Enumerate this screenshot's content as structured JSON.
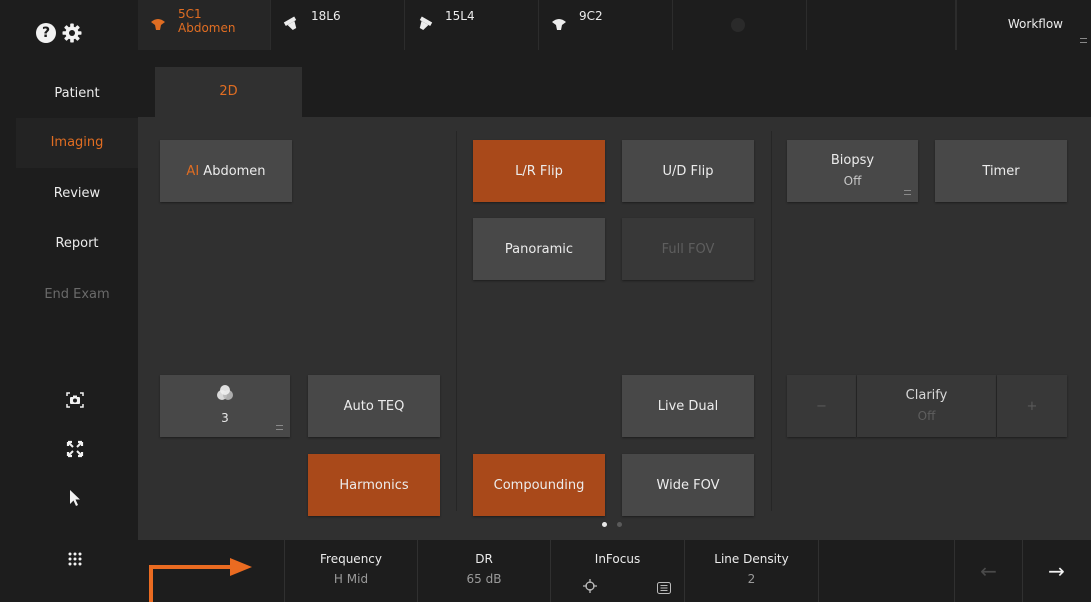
{
  "header": {
    "help_glyph": "?",
    "settings_icon": "gear-icon"
  },
  "probes": [
    {
      "name": "5C1",
      "sub": "Abdomen",
      "active": true,
      "icon": "curved-probe-icon"
    },
    {
      "name": "18L6",
      "active": false,
      "icon": "linear-probe-icon"
    },
    {
      "name": "15L4",
      "active": false,
      "icon": "linear-probe-icon"
    },
    {
      "name": "9C2",
      "active": false,
      "icon": "curved-probe-icon"
    }
  ],
  "workflow_label": "Workflow",
  "nav": [
    "Patient",
    "Imaging",
    "Review",
    "Report",
    "End Exam"
  ],
  "tab_label": "2D",
  "buttons": {
    "ai_prefix": "AI",
    "ai_label": "Abdomen",
    "lr_flip": "L/R Flip",
    "ud_flip": "U/D Flip",
    "biopsy": "Biopsy",
    "biopsy_value": "Off",
    "timer": "Timer",
    "panoramic": "Panoramic",
    "full_fov": "Full FOV",
    "colorize_value": "3",
    "auto_teq": "Auto TEQ",
    "live_dual": "Live Dual",
    "clarify": "Clarify",
    "clarify_value": "Off",
    "clarify_minus": "−",
    "clarify_plus": "+",
    "harmonics": "Harmonics",
    "compounding": "Compounding",
    "wide_fov": "Wide FOV"
  },
  "bottom": {
    "frequency_label": "Frequency",
    "frequency_value": "H Mid",
    "dr_label": "DR",
    "dr_value": "65 dB",
    "infocus_label": "InFocus",
    "line_density_label": "Line Density",
    "line_density_value": "2",
    "prev_glyph": "←",
    "next_glyph": "→"
  },
  "colors": {
    "accent": "#e06d22",
    "button_on": "#a9491a",
    "button": "#484848",
    "panel": "#303030",
    "chrome": "#1d1d1d",
    "callout": "#ea6b21"
  },
  "page_indicator": {
    "current": 1,
    "total": 2
  }
}
